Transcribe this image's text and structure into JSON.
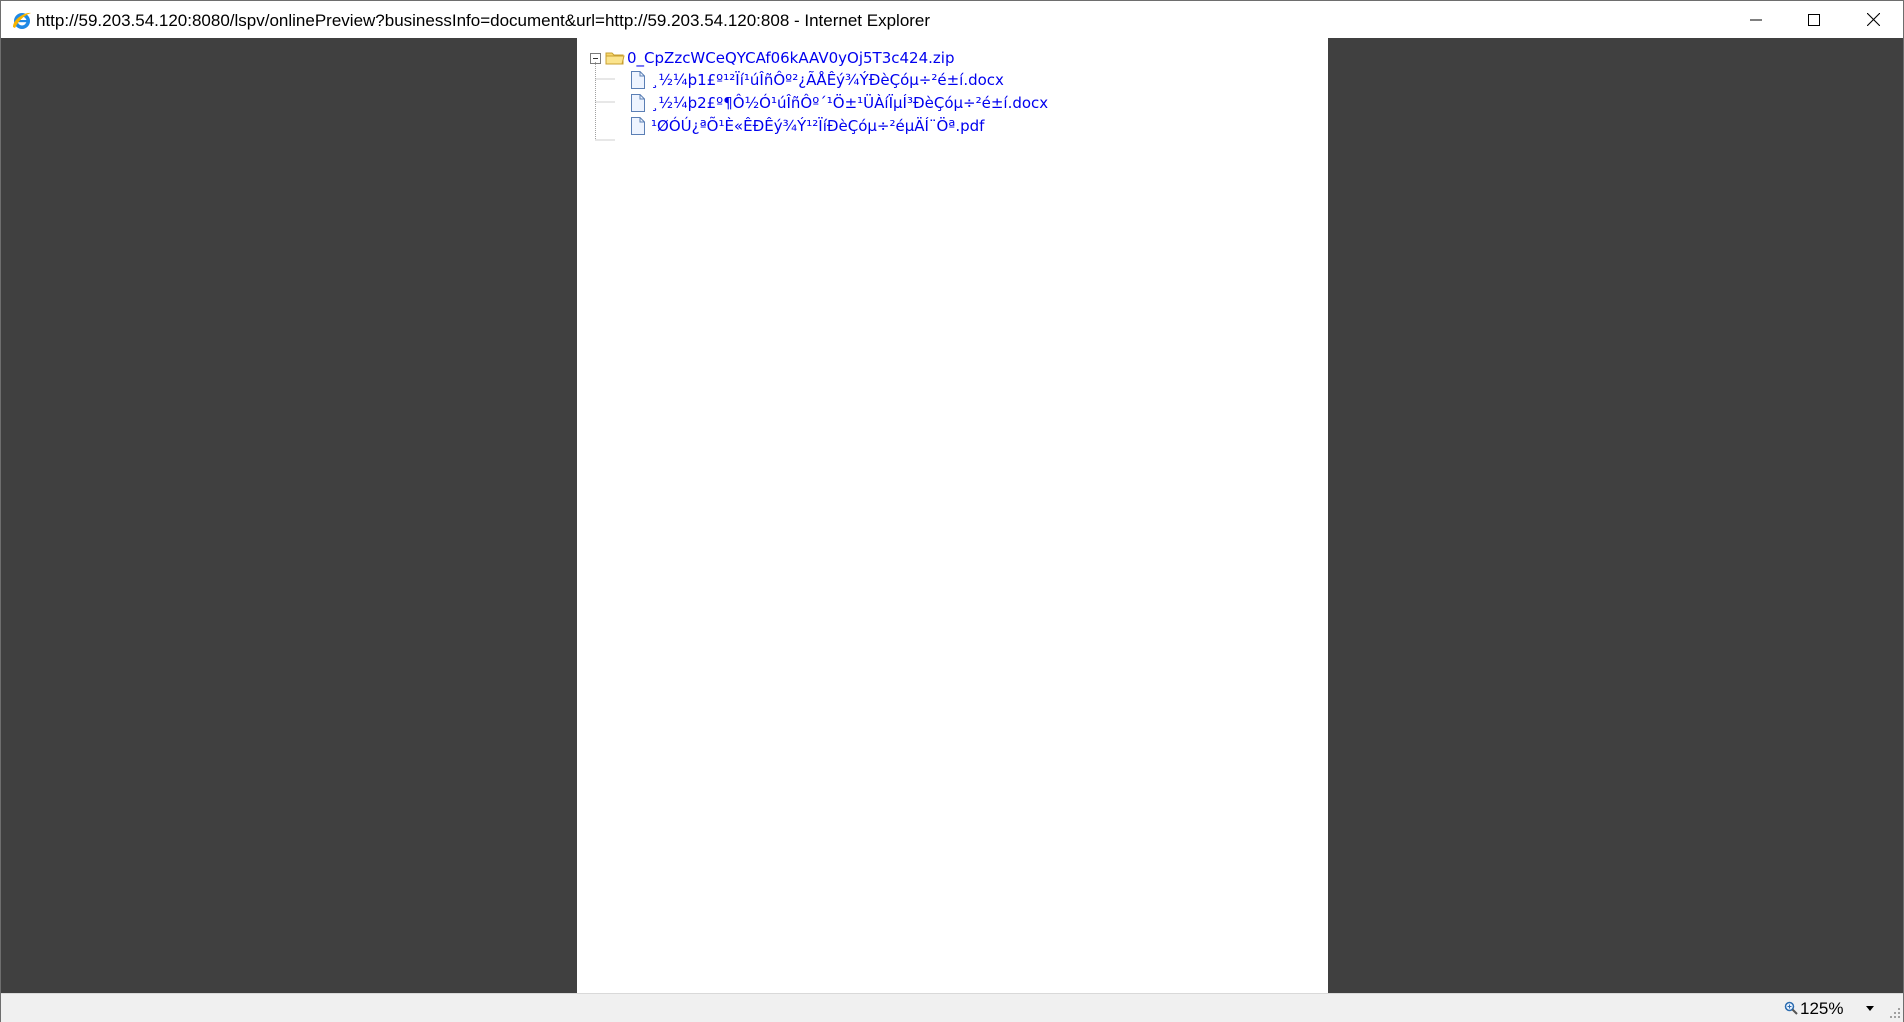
{
  "window": {
    "title": "http://59.203.54.120:8080/lspv/onlinePreview?businessInfo=document&url=http://59.203.54.120:808 - Internet Explorer",
    "icon": "internet-explorer-icon",
    "controls": [
      "minimize-icon",
      "maximize-icon",
      "close-icon"
    ]
  },
  "tree": {
    "root": {
      "label": "0_CpZzcWCeQYCAf06kAAV0yOj5T3c424.zip",
      "icon": "folder-icon",
      "expanded": true
    },
    "children": [
      {
        "label": "¸½¼þ1£º¹²Ïí¹úÎñÔº²¿ÃÅÊý¾ÝÐèÇóµ÷²é±í.docx",
        "icon": "file-icon"
      },
      {
        "label": "¸½¼þ2£º¶Ô½Ó¹úÎñÔº´¹Ö±¹ÜÀíÏµÍ³ÐèÇóµ÷²é±í.docx",
        "icon": "file-icon"
      },
      {
        "label": "¹ØÓÚ¿ªÕ¹È«ÊÐÊý¾Ý¹²ÏíÐèÇóµ÷²éµÄÍ¨Öª.pdf",
        "icon": "file-icon"
      }
    ]
  },
  "statusbar": {
    "zoom": "125%",
    "zoom_icon": "magnifier-icon",
    "dropdown_icon": "chevron-down-icon"
  },
  "colors": {
    "background": "#404040",
    "page": "#ffffff",
    "link": "#0000ee",
    "statusbar": "#f0f0f0"
  }
}
